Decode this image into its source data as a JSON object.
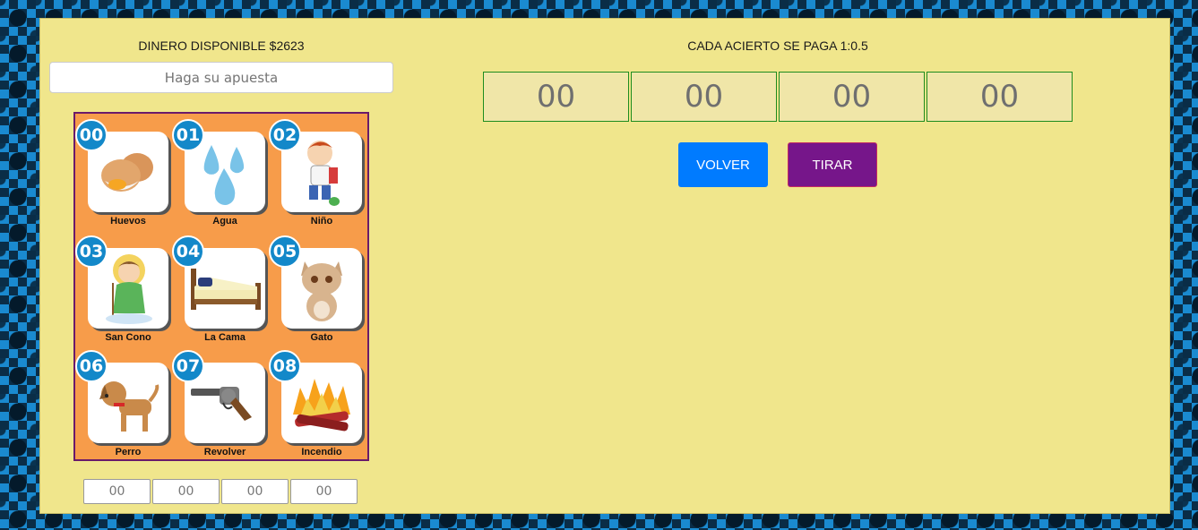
{
  "left": {
    "money_label": "DINERO DISPONIBLE $2623",
    "bet_placeholder": "Haga su apuesta",
    "board": [
      {
        "num": "00",
        "name": "Huevos",
        "icon": "eggs-icon"
      },
      {
        "num": "01",
        "name": "Agua",
        "icon": "water-drops-icon"
      },
      {
        "num": "02",
        "name": "Niño",
        "icon": "child-icon"
      },
      {
        "num": "03",
        "name": "San Cono",
        "icon": "saint-icon"
      },
      {
        "num": "04",
        "name": "La Cama",
        "icon": "bed-icon"
      },
      {
        "num": "05",
        "name": "Gato",
        "icon": "cat-icon"
      },
      {
        "num": "06",
        "name": "Perro",
        "icon": "dog-icon"
      },
      {
        "num": "07",
        "name": "Revolver",
        "icon": "revolver-icon"
      },
      {
        "num": "08",
        "name": "Incendio",
        "icon": "fire-icon"
      }
    ],
    "picks": [
      "00",
      "00",
      "00",
      "00"
    ]
  },
  "right": {
    "pay_label": "CADA ACIERTO SE PAGA 1:0.5",
    "slots": [
      "00",
      "00",
      "00",
      "00"
    ],
    "volver_label": "VOLVER",
    "tirar_label": "TIRAR"
  },
  "colors": {
    "panel": "#f0e68c",
    "board": "#f79c4a",
    "number_badge": "#1388c9",
    "volver": "#007bff",
    "tirar": "#76168a"
  }
}
